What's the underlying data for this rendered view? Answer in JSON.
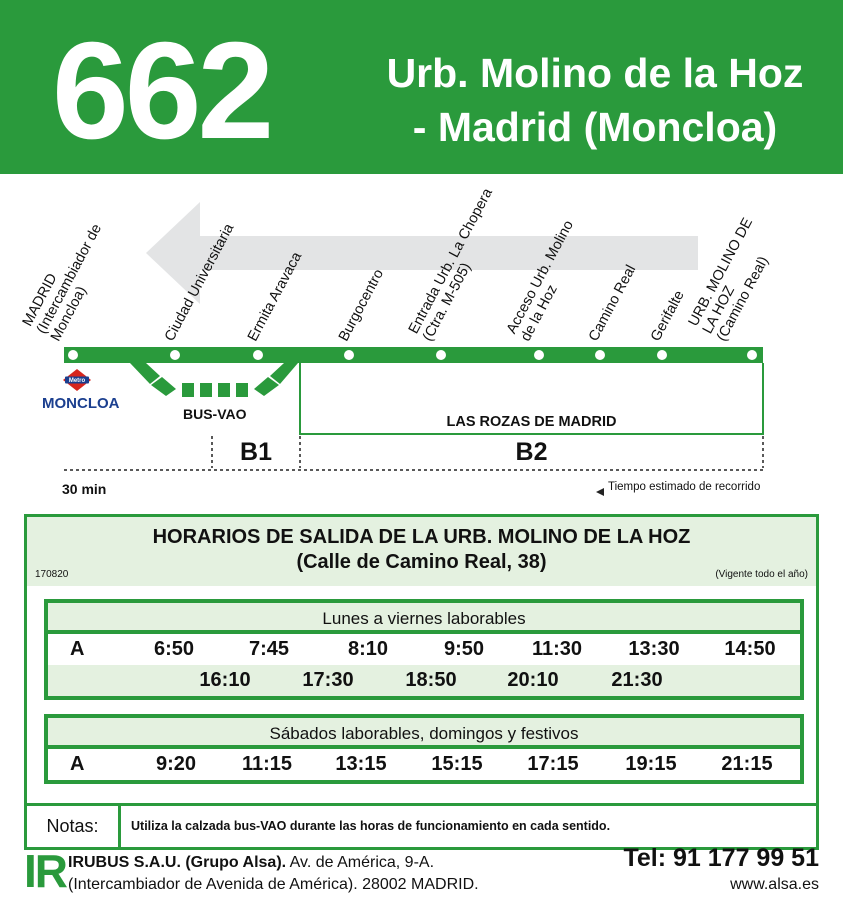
{
  "header": {
    "line_number": "662",
    "title_line1": "Urb. Molino de la Hoz",
    "title_line2": "- Madrid (Moncloa)"
  },
  "stops": [
    "MADRID\n(Intercambiador de\nMoncloa)",
    "Ciudad Universitaria",
    "Ermita Aravaca",
    "Burgocentro",
    "Entrada Urb. La Chopera\n(Ctra. M-505)",
    "Acceso Urb. Molino\nde la Hoz",
    "Camino Real",
    "Gerifalte",
    "URB. MOLINO DE\nLA HOZ\n(Camino Real)"
  ],
  "diagram": {
    "metro_label": "Metro",
    "metro_station": "MONCLOA",
    "busvao_label": "BUS-VAO",
    "municipality": "LAS ROZAS DE MADRID",
    "zone_b1": "B1",
    "zone_b2": "B2",
    "travel_time": "30 min",
    "travel_time_caption": "Tiempo estimado de recorrido"
  },
  "timetable": {
    "title_line1": "HORARIOS DE SALIDA DE LA URB. MOLINO DE LA HOZ",
    "title_line2": "(Calle de Camino Real, 38)",
    "code": "170820",
    "validity": "(Vigente todo el año)",
    "weekdays": {
      "heading": "Lunes a viernes laborables",
      "route": "A",
      "row1": [
        "6:50",
        "7:45",
        "8:10",
        "9:50",
        "11:30",
        "13:30",
        "14:50"
      ],
      "row2": [
        "16:10",
        "17:30",
        "18:50",
        "20:10",
        "21:30"
      ]
    },
    "weekend": {
      "heading": "Sábados laborables, domingos y festivos",
      "route": "A",
      "row1": [
        "9:20",
        "11:15",
        "13:15",
        "15:15",
        "17:15",
        "19:15",
        "21:15"
      ]
    },
    "notes_label": "Notas:",
    "notes_text": "Utiliza la calzada bus-VAO durante las horas de funcionamiento en cada sentido."
  },
  "footer": {
    "logo": "IR",
    "company_name": "IRUBUS S.A.U. (Grupo Alsa).",
    "address_line1": "Av. de América, 9-A.",
    "address_line2": "(Intercambiador de Avenida de América). 28002 MADRID.",
    "phone": "Tel: 91 177 99 51",
    "website": "www.alsa.es"
  },
  "colors": {
    "brand_green": "#2a9a3c",
    "light_green": "#e4f1e0",
    "metro_blue": "#1b3f8f",
    "metro_red": "#d7261e"
  }
}
